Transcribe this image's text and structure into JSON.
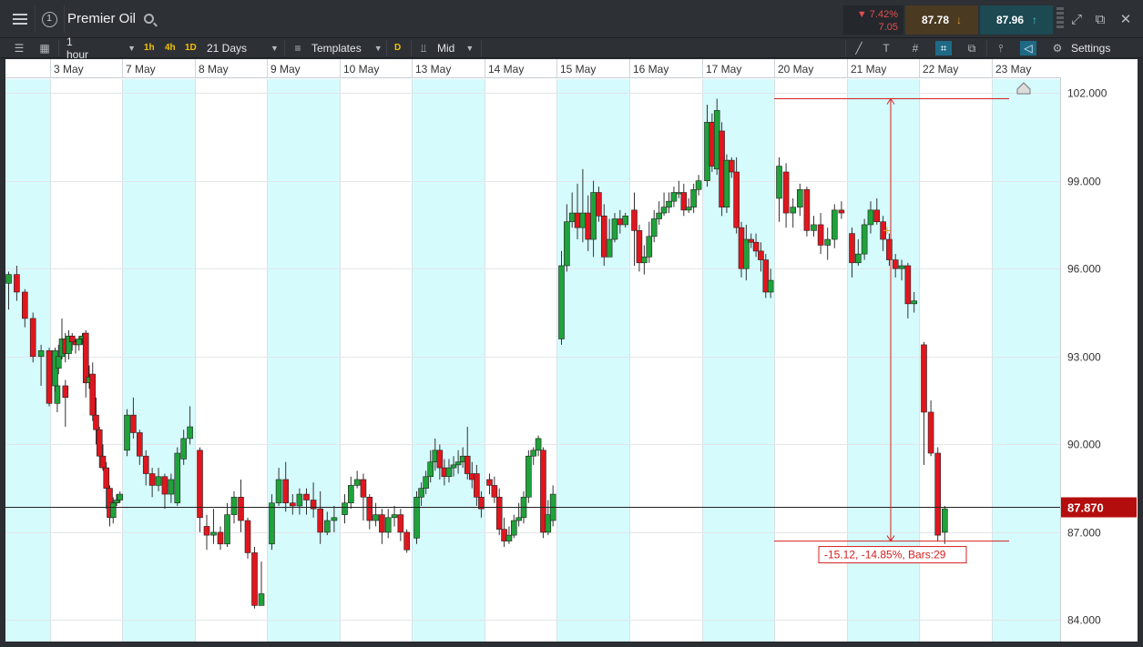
{
  "titlebar": {
    "instrument": "Premier Oil",
    "change_pct": "▼ 7.42%",
    "change_abs": "7.05",
    "sell_price": "87.78",
    "buy_price": "87.96",
    "icons": [
      "menu-icon",
      "info-icon",
      "search-icon",
      "expand-icon",
      "popout-icon",
      "close-icon"
    ]
  },
  "toolbar": {
    "interval": "1 hour",
    "quick_frames": [
      "1h",
      "4h",
      "1D"
    ],
    "range": "21 Days",
    "templates": "Templates",
    "price_type_badge": "D",
    "price_type": "Mid",
    "settings": "Settings"
  },
  "chart_data": {
    "type": "candlestick",
    "instrument": "Premier Oil",
    "interval": "1 hour",
    "current_price": "87.870",
    "y_axis_ticks": [
      "102.000",
      "99.000",
      "96.000",
      "93.000",
      "90.000",
      "87.000",
      "84.000"
    ],
    "ylim": [
      83.3,
      102.5
    ],
    "x_axis_labels": [
      "3 May",
      "7 May",
      "8 May",
      "9 May",
      "10 May",
      "13 May",
      "14 May",
      "15 May",
      "16 May",
      "17 May",
      "20 May",
      "21 May",
      "22 May",
      "23 May"
    ],
    "measurement": {
      "label": "-15.12, -14.85%, Bars:29",
      "from": 101.8,
      "to": 86.7
    },
    "days": [
      {
        "label": "3 May",
        "candles": [
          [
            95.5,
            95.8,
            95.9,
            94.6
          ],
          [
            95.8,
            95.2,
            96.1,
            94.9
          ],
          [
            95.2,
            94.3,
            95.3,
            94.0
          ],
          [
            94.3,
            93.0,
            94.5,
            92.8
          ],
          [
            93.0,
            93.2,
            93.4,
            92.0
          ],
          [
            93.2,
            91.4,
            93.3,
            91.3
          ],
          [
            91.4,
            92.0,
            92.4,
            91.1
          ],
          [
            92.0,
            91.6,
            92.2,
            90.6
          ]
        ]
      },
      {
        "label": "7 May",
        "candles": [
          [
            92.0,
            93.2,
            93.3,
            91.8
          ],
          [
            92.6,
            93.0,
            93.4,
            92.4
          ],
          [
            93.0,
            93.6,
            94.3,
            92.9
          ],
          [
            93.6,
            93.1,
            93.8,
            92.8
          ],
          [
            93.1,
            93.7,
            93.9,
            92.9
          ],
          [
            93.7,
            93.5,
            93.8,
            93.2
          ],
          [
            93.5,
            93.4,
            93.6,
            93.1
          ],
          [
            93.4,
            93.6,
            93.7,
            93.2
          ],
          [
            93.6,
            93.7,
            93.8,
            93.4
          ],
          [
            93.8,
            92.1,
            93.9,
            91.6
          ],
          [
            92.1,
            92.3,
            92.7,
            91.9
          ],
          [
            92.4,
            91.0,
            92.8,
            90.8
          ],
          [
            91.0,
            90.5,
            91.6,
            90.0
          ],
          [
            90.5,
            89.6,
            90.6,
            89.2
          ],
          [
            89.6,
            89.2,
            90.0,
            89.1
          ],
          [
            89.2,
            88.5,
            89.4,
            87.8
          ],
          [
            88.5,
            87.5,
            88.6,
            87.2
          ],
          [
            87.5,
            88.0,
            88.2,
            87.3
          ],
          [
            88.0,
            88.1,
            88.3,
            87.9
          ],
          [
            88.1,
            88.3,
            88.4,
            88.0
          ]
        ]
      },
      {
        "label": "8 May",
        "candles": [
          [
            89.8,
            91.0,
            91.2,
            89.6
          ],
          [
            91.0,
            90.4,
            91.6,
            90.2
          ],
          [
            90.4,
            89.6,
            90.5,
            89.3
          ],
          [
            89.6,
            89.0,
            89.8,
            88.6
          ],
          [
            89.0,
            88.6,
            89.2,
            88.2
          ],
          [
            88.6,
            88.9,
            89.2,
            88.4
          ],
          [
            88.9,
            88.3,
            89.0,
            87.8
          ],
          [
            88.3,
            88.8,
            89.0,
            88.0
          ],
          [
            88.0,
            89.7,
            89.9,
            87.9
          ],
          [
            89.5,
            90.2,
            90.5,
            89.3
          ],
          [
            90.2,
            90.6,
            91.3,
            90.0
          ]
        ]
      },
      {
        "label": "9 May",
        "candles": [
          [
            89.8,
            87.5,
            89.9,
            87.0
          ],
          [
            87.2,
            86.9,
            87.6,
            86.4
          ],
          [
            86.9,
            87.0,
            87.8,
            86.6
          ],
          [
            87.0,
            86.6,
            87.2,
            86.4
          ],
          [
            86.6,
            87.6,
            88.0,
            86.5
          ],
          [
            87.6,
            88.2,
            88.4,
            87.3
          ],
          [
            88.2,
            87.4,
            88.8,
            87.0
          ],
          [
            87.4,
            86.3,
            87.5,
            86.1
          ],
          [
            86.3,
            84.5,
            86.5,
            84.4
          ],
          [
            84.5,
            84.9,
            86.0,
            84.6
          ]
        ]
      },
      {
        "label": "10 May",
        "candles": [
          [
            86.6,
            88.0,
            88.3,
            86.4
          ],
          [
            88.0,
            88.8,
            89.2,
            87.9
          ],
          [
            88.8,
            88.0,
            89.4,
            87.7
          ],
          [
            88.0,
            87.9,
            88.3,
            87.6
          ],
          [
            87.9,
            88.3,
            88.5,
            87.6
          ],
          [
            88.3,
            88.1,
            88.5,
            87.6
          ],
          [
            88.1,
            87.8,
            88.7,
            87.5
          ],
          [
            87.8,
            87.0,
            88.4,
            86.6
          ],
          [
            87.0,
            87.4,
            87.7,
            86.9
          ],
          [
            87.4,
            87.5,
            87.9,
            87.0
          ]
        ]
      },
      {
        "label": "13 May",
        "candles": [
          [
            87.6,
            88.0,
            88.3,
            87.3
          ],
          [
            88.0,
            88.6,
            88.9,
            87.8
          ],
          [
            88.6,
            88.8,
            89.1,
            88.5
          ],
          [
            88.8,
            88.2,
            89.0,
            87.4
          ],
          [
            88.2,
            87.4,
            88.3,
            87.1
          ],
          [
            87.4,
            87.6,
            88.0,
            87.2
          ],
          [
            87.6,
            87.0,
            87.8,
            86.6
          ],
          [
            87.0,
            87.5,
            87.8,
            86.8
          ],
          [
            87.5,
            87.6,
            87.9,
            87.2
          ],
          [
            87.6,
            87.0,
            87.8,
            86.7
          ],
          [
            87.0,
            86.4,
            87.1,
            86.3
          ]
        ]
      },
      {
        "label": "14 May",
        "candles": [
          [
            86.8,
            88.2,
            88.4,
            86.6
          ],
          [
            88.2,
            88.5,
            88.7,
            87.9
          ],
          [
            88.5,
            88.9,
            89.1,
            88.3
          ],
          [
            88.9,
            89.4,
            89.8,
            88.7
          ],
          [
            89.4,
            89.8,
            90.2,
            89.1
          ],
          [
            89.8,
            89.2,
            90.0,
            88.8
          ],
          [
            89.2,
            88.9,
            89.5,
            88.6
          ],
          [
            88.9,
            89.2,
            89.5,
            88.7
          ],
          [
            89.2,
            89.3,
            89.6,
            88.9
          ],
          [
            89.3,
            89.4,
            89.8,
            89.0
          ],
          [
            89.4,
            89.6,
            89.9,
            89.2
          ],
          [
            89.6,
            89.0,
            90.6,
            88.8
          ],
          [
            89.0,
            88.8,
            89.4,
            88.5
          ],
          [
            89.0,
            88.2,
            89.3,
            87.9
          ],
          [
            88.2,
            87.8,
            88.4,
            87.5
          ]
        ]
      },
      {
        "label": "15 May",
        "candles": [
          [
            88.8,
            88.6,
            89.0,
            88.3
          ],
          [
            88.6,
            88.2,
            88.9,
            88.0
          ],
          [
            88.2,
            87.1,
            88.5,
            86.9
          ],
          [
            87.1,
            86.7,
            87.5,
            86.5
          ],
          [
            86.7,
            86.9,
            87.2,
            86.6
          ],
          [
            86.9,
            87.4,
            87.6,
            86.8
          ],
          [
            87.4,
            87.5,
            88.0,
            87.2
          ],
          [
            87.5,
            88.2,
            88.4,
            87.3
          ],
          [
            88.2,
            89.6,
            89.8,
            88.0
          ],
          [
            89.6,
            89.8,
            89.9,
            89.3
          ],
          [
            89.8,
            90.2,
            90.3,
            89.6
          ],
          [
            89.8,
            87.0,
            89.9,
            86.8
          ],
          [
            87.0,
            87.6,
            88.1,
            86.9
          ],
          [
            87.4,
            88.3,
            88.6,
            87.2
          ]
        ]
      },
      {
        "label": "16 May",
        "candles": [
          [
            93.6,
            96.1,
            96.6,
            93.4
          ],
          [
            96.1,
            97.6,
            98.2,
            95.9
          ],
          [
            97.6,
            97.9,
            98.6,
            97.4
          ],
          [
            97.9,
            97.4,
            98.9,
            97.0
          ],
          [
            97.4,
            97.9,
            99.4,
            96.9
          ],
          [
            97.9,
            97.0,
            98.5,
            96.6
          ],
          [
            97.0,
            98.6,
            99.0,
            96.4
          ],
          [
            98.6,
            97.8,
            98.8,
            97.6
          ],
          [
            97.8,
            96.4,
            98.2,
            96.1
          ],
          [
            96.4,
            97.0,
            97.7,
            96.5
          ],
          [
            97.0,
            97.7,
            97.9,
            96.9
          ],
          [
            97.7,
            97.5,
            98.0,
            97.2
          ],
          [
            97.5,
            97.8,
            97.9,
            97.4
          ]
        ]
      },
      {
        "label": "17 May",
        "candles": [
          [
            98.0,
            97.3,
            98.6,
            96.1
          ],
          [
            97.3,
            96.2,
            97.5,
            95.9
          ],
          [
            96.2,
            96.4,
            96.8,
            95.8
          ],
          [
            96.4,
            97.1,
            97.6,
            96.2
          ],
          [
            97.1,
            97.7,
            98.0,
            96.9
          ],
          [
            97.7,
            97.9,
            98.3,
            97.5
          ],
          [
            97.9,
            98.1,
            98.6,
            97.8
          ],
          [
            98.1,
            98.3,
            98.6,
            97.9
          ],
          [
            98.3,
            98.6,
            98.8,
            98.1
          ],
          [
            98.6,
            98.6,
            99.0,
            98.4
          ],
          [
            98.6,
            98.0,
            98.9,
            97.8
          ],
          [
            98.0,
            98.1,
            98.4,
            97.9
          ],
          [
            98.1,
            98.7,
            98.9,
            97.9
          ],
          [
            98.7,
            99.0,
            99.2,
            98.5
          ]
        ]
      },
      {
        "label": "20 May",
        "candles": [
          [
            99.0,
            101.0,
            101.6,
            98.8
          ],
          [
            101.0,
            99.5,
            101.3,
            99.3
          ],
          [
            99.4,
            101.4,
            101.8,
            99.2
          ],
          [
            100.7,
            98.1,
            101.0,
            97.8
          ],
          [
            98.1,
            99.7,
            99.9,
            97.9
          ],
          [
            99.7,
            99.3,
            99.8,
            99.1
          ],
          [
            99.3,
            97.4,
            99.8,
            97.2
          ],
          [
            97.4,
            96.0,
            97.6,
            95.7
          ],
          [
            96.0,
            97.0,
            97.5,
            95.6
          ],
          [
            97.0,
            96.9,
            97.2,
            96.7
          ],
          [
            96.9,
            96.6,
            97.2,
            96.4
          ],
          [
            96.6,
            96.3,
            96.9,
            95.9
          ],
          [
            96.3,
            95.2,
            96.5,
            95.0
          ],
          [
            95.2,
            95.6,
            96.0,
            95.0
          ]
        ]
      },
      {
        "label": "21 May",
        "candles": [
          [
            98.4,
            99.5,
            99.8,
            97.6
          ],
          [
            99.3,
            97.9,
            99.6,
            97.4
          ],
          [
            97.9,
            98.1,
            98.4,
            97.4
          ],
          [
            98.1,
            98.7,
            98.9,
            97.8
          ],
          [
            98.7,
            97.3,
            98.8,
            97.1
          ],
          [
            97.3,
            97.5,
            97.8,
            97.1
          ],
          [
            97.5,
            96.8,
            97.9,
            96.5
          ],
          [
            96.8,
            97.0,
            97.4,
            96.3
          ],
          [
            97.0,
            98.0,
            98.2,
            96.7
          ],
          [
            98.0,
            97.9,
            98.3,
            97.7
          ]
        ]
      },
      {
        "label": "22 May",
        "candles": [
          [
            97.2,
            96.2,
            97.4,
            95.7
          ],
          [
            96.2,
            96.5,
            97.0,
            96.1
          ],
          [
            96.5,
            97.5,
            97.7,
            96.3
          ],
          [
            97.5,
            98.0,
            98.3,
            97.2
          ],
          [
            98.0,
            97.6,
            98.4,
            97.5
          ],
          [
            97.6,
            97.0,
            97.8,
            96.6
          ],
          [
            97.0,
            96.3,
            97.2,
            96.1
          ],
          [
            96.3,
            96.0,
            96.5,
            95.7
          ],
          [
            96.0,
            96.1,
            96.3,
            95.6
          ],
          [
            96.1,
            94.8,
            96.2,
            94.3
          ],
          [
            94.8,
            94.9,
            95.2,
            94.5
          ]
        ]
      },
      {
        "label": "23 May",
        "candles": [
          [
            93.4,
            91.1,
            93.5,
            89.3
          ],
          [
            91.1,
            89.7,
            91.5,
            89.6
          ],
          [
            89.7,
            86.9,
            89.9,
            86.7
          ],
          [
            87.0,
            87.8,
            87.9,
            86.6
          ]
        ]
      }
    ]
  }
}
